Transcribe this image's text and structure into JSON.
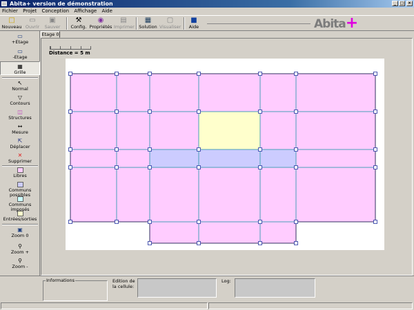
{
  "window": {
    "title": "Abita+ version de démonstration"
  },
  "window_controls": {
    "minimize": "_",
    "maximize": "□",
    "close": "×"
  },
  "menu": [
    "Fichier",
    "Projet",
    "Conception",
    "Affichage",
    "Aide"
  ],
  "toolbar": [
    {
      "key": "nouveau",
      "label": "Nouveau",
      "icon": "new-file-icon",
      "enabled": true
    },
    {
      "key": "ouvrir",
      "label": "Ouvrir",
      "icon": "open-folder-icon",
      "enabled": false
    },
    {
      "key": "sauver",
      "label": "Sauver",
      "icon": "save-disk-icon",
      "enabled": false
    },
    {
      "key": "config",
      "label": "Config.",
      "icon": "tools-icon",
      "enabled": true
    },
    {
      "key": "proprietes",
      "label": "Propriétés",
      "icon": "properties-icon",
      "enabled": true
    },
    {
      "key": "imprimer",
      "label": "Imprimer",
      "icon": "printer-icon",
      "enabled": false
    },
    {
      "key": "solution",
      "label": "Solution",
      "icon": "solution-icon",
      "enabled": true
    },
    {
      "key": "visualiser",
      "label": "Visualiser",
      "icon": "visualize-icon",
      "enabled": false
    },
    {
      "key": "aide",
      "label": "Aide",
      "icon": "help-icon",
      "enabled": true
    }
  ],
  "logo": {
    "text": "Abita",
    "plus": "+"
  },
  "palette": [
    {
      "key": "add-etage",
      "label": "+Etage",
      "icon": "add-floor-icon"
    },
    {
      "key": "remove-etage",
      "label": "-Etage",
      "icon": "remove-floor-icon"
    },
    {
      "key": "grille",
      "label": "Grille",
      "icon": "grid-icon",
      "selected": true
    },
    {
      "key": "normal",
      "label": "Normal",
      "icon": "pointer-icon"
    },
    {
      "key": "contours",
      "label": "Contours",
      "icon": "outline-icon"
    },
    {
      "key": "structures",
      "label": "Structures",
      "icon": "structure-icon"
    },
    {
      "key": "mesure",
      "label": "Mesure",
      "icon": "measure-icon"
    },
    {
      "key": "deplacer",
      "label": "Déplacer",
      "icon": "move-icon"
    },
    {
      "key": "supprimer",
      "label": "Supprimer",
      "icon": "delete-icon"
    },
    {
      "key": "libres",
      "label": "Libres",
      "swatch": "#ffccff"
    },
    {
      "key": "communs-possibles",
      "label": "Communs possibles",
      "swatch": "#ccccff"
    },
    {
      "key": "communs-imposes",
      "label": "Communs imposés",
      "swatch": "#ccffff"
    },
    {
      "key": "entrees-sorties",
      "label": "Entrées/sorties",
      "swatch": "#ffffcc"
    },
    {
      "key": "zoom0",
      "label": "Zoom 0",
      "icon": "zoom-reset-icon"
    },
    {
      "key": "zoom-in",
      "label": "Zoom +",
      "icon": "zoom-in-icon"
    },
    {
      "key": "zoom-out",
      "label": "Zoom -",
      "icon": "zoom-out-icon"
    }
  ],
  "tab": {
    "label": "Etage 0"
  },
  "distance": "Distance = 5 m",
  "colors": {
    "libres": "#ffccff",
    "communs_possibles": "#ccccff",
    "entrees_sorties": "#ffffcc",
    "grid_line": "#4aa0b8",
    "node_fill": "#ffffff",
    "node_stroke": "#2030a0"
  },
  "bottom": {
    "informations": "Informations",
    "edition": "Edition de la cellule:",
    "log": "Log:"
  }
}
